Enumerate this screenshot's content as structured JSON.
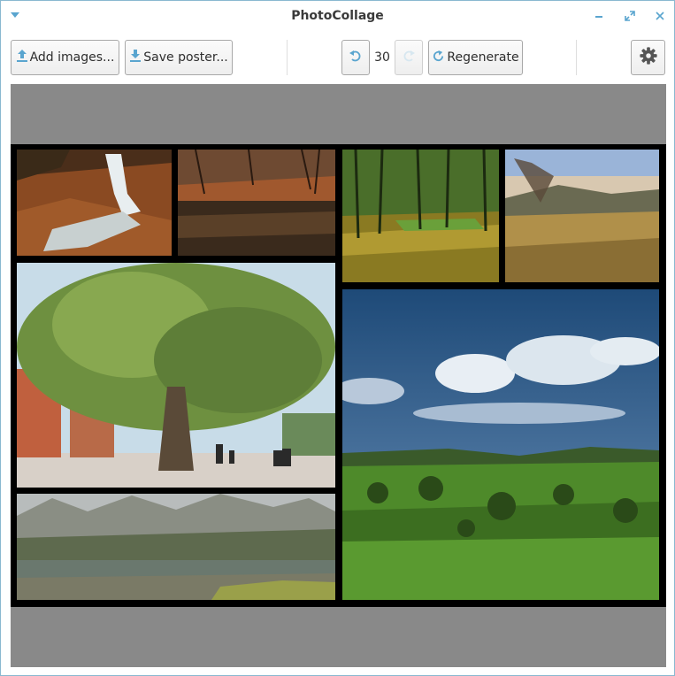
{
  "window": {
    "title": "PhotoCollage"
  },
  "toolbar": {
    "add_images_label": "Add images...",
    "save_poster_label": "Save poster...",
    "history_count": "30",
    "regenerate_label": "Regenerate"
  },
  "colors": {
    "accent": "#5aa5cf",
    "canvas_background": "#898989",
    "poster_background": "#000000"
  },
  "icons": {
    "add_images": "upload-arrow-icon",
    "save_poster": "download-arrow-icon",
    "undo": "undo-icon",
    "redo": "redo-icon",
    "regenerate": "refresh-icon",
    "settings": "gear-icon"
  },
  "collage": {
    "photos": [
      {
        "subject": "waterfall in autumn forest"
      },
      {
        "subject": "forest pond reflection"
      },
      {
        "subject": "sunlit forest clearing"
      },
      {
        "subject": "dry meadow hills at dusk"
      },
      {
        "subject": "large plane tree in city square"
      },
      {
        "subject": "green valley under cloudy sky"
      },
      {
        "subject": "mountain lake with rocky peaks"
      }
    ]
  }
}
